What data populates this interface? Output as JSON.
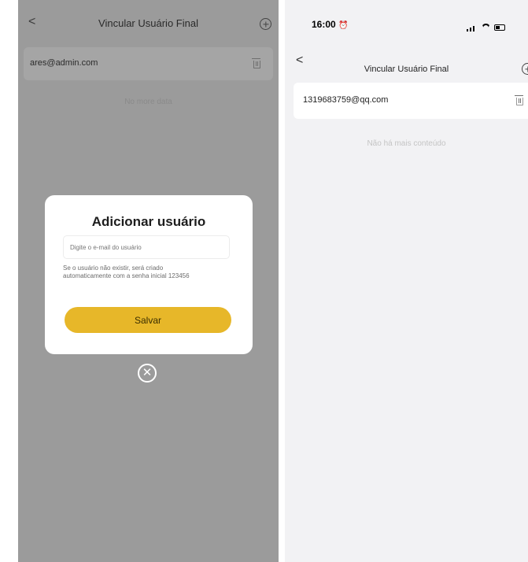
{
  "left": {
    "header": {
      "back_glyph": "<",
      "title": "Vincular Usuário Final"
    },
    "row": {
      "email": "ares@admin.com"
    },
    "no_more": "No more data",
    "modal": {
      "title": "Adicionar usuário",
      "input_placeholder": "Digite o e-mail do usuário",
      "hint": "Se o usuário não existir, será criado automaticamente com a senha inicial 123456",
      "save_label": "Salvar"
    },
    "close_glyph": "✕"
  },
  "right": {
    "status": {
      "time": "16:00",
      "alarm_glyph": "⏰"
    },
    "header": {
      "back_glyph": "<",
      "title": "Vincular Usuário Final"
    },
    "row": {
      "email": "1319683759@qq.com"
    },
    "no_more": "Não há mais conteúdo"
  },
  "colors": {
    "accent": "#e7b729",
    "overlay": "#9b9b9b",
    "background": "#f2f2f4"
  }
}
